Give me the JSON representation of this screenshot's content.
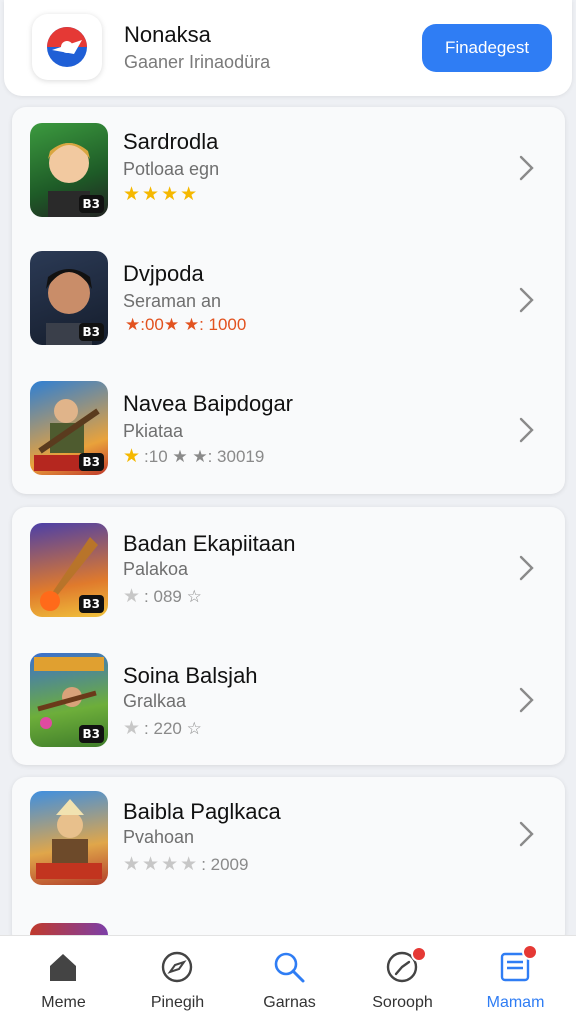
{
  "header": {
    "app_name": "Nonaksa",
    "app_subtitle": "Gaaner Irinaodüra",
    "action_label": "Finadegest",
    "accent_color": "#2f7df4"
  },
  "games": [
    {
      "title": "Sardrodla",
      "subtitle": "Potloaa      egn",
      "stars_filled": 4,
      "stars_total": 4,
      "rating_text": "",
      "badge": "B3"
    },
    {
      "title": "Dvjpoda",
      "subtitle": "Seraman   an",
      "stars_filled": 2,
      "stars_total": 2,
      "rating_text": "★:00★ ★: 1000",
      "badge": "B3"
    },
    {
      "title": "Navea Baipdogar",
      "subtitle": "Pkiataa",
      "stars_filled": 1,
      "stars_total": 3,
      "rating_text": ":10 ★ ★: 30019",
      "badge": "B3"
    },
    {
      "title": "Badan Ekapiitaan",
      "subtitle": "Palakoa",
      "stars_filled": 0,
      "stars_total": 1,
      "rating_text": ": 089 ☆",
      "badge": "B3"
    },
    {
      "title": "Soina Balsjah",
      "subtitle": "Gralkaa",
      "stars_filled": 0,
      "stars_total": 1,
      "rating_text": ": 220 ☆",
      "badge": "B3"
    },
    {
      "title": "Baibla Paglkaca",
      "subtitle": "Pvahoan",
      "stars_filled": 0,
      "stars_total": 4,
      "rating_text": ": 2009",
      "badge": "B3"
    }
  ],
  "nav": [
    {
      "label": "Meme",
      "icon": "home-icon"
    },
    {
      "label": "Pinegih",
      "icon": "compass-icon"
    },
    {
      "label": "Garnas",
      "icon": "search-icon"
    },
    {
      "label": "Sorooph",
      "icon": "clock-icon"
    },
    {
      "label": "Mamam",
      "icon": "inbox-icon"
    }
  ]
}
